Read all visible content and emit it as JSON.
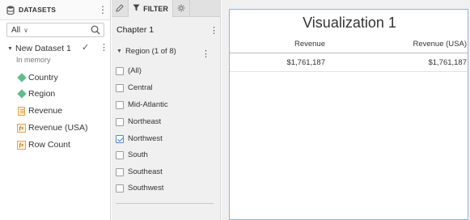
{
  "datasets_panel": {
    "title": "DATASETS",
    "filter_select": "All",
    "dataset": {
      "name": "New Dataset 1",
      "subtitle": "In memory"
    },
    "fields": [
      {
        "label": "Country",
        "icon": "dimension-diamond-icon"
      },
      {
        "label": "Region",
        "icon": "dimension-diamond-icon"
      },
      {
        "label": "Revenue",
        "icon": "measure-icon"
      },
      {
        "label": "Revenue (USA)",
        "icon": "calculated-measure-icon"
      },
      {
        "label": "Row Count",
        "icon": "calculated-measure-icon"
      }
    ]
  },
  "filter_panel": {
    "tabs": {
      "filter_label": "FILTER"
    },
    "chapter_title": "Chapter 1",
    "group_label": "Region (1 of 8)",
    "options": [
      {
        "label": "(All)",
        "checked": false
      },
      {
        "label": "Central",
        "checked": false
      },
      {
        "label": "Mid-Atlantic",
        "checked": false
      },
      {
        "label": "Northeast",
        "checked": false
      },
      {
        "label": "Northwest",
        "checked": true
      },
      {
        "label": "South",
        "checked": false
      },
      {
        "label": "Southeast",
        "checked": false
      },
      {
        "label": "Southwest",
        "checked": false
      }
    ]
  },
  "visualization": {
    "title": "Visualization 1",
    "columns": [
      "Revenue",
      "Revenue (USA)"
    ],
    "rows": [
      [
        "$1,761,187",
        "$1,761,187"
      ]
    ]
  },
  "colors": {
    "accent": "#3b82d6",
    "dimension": "#5fbd8c",
    "measure": "#e8a247"
  }
}
